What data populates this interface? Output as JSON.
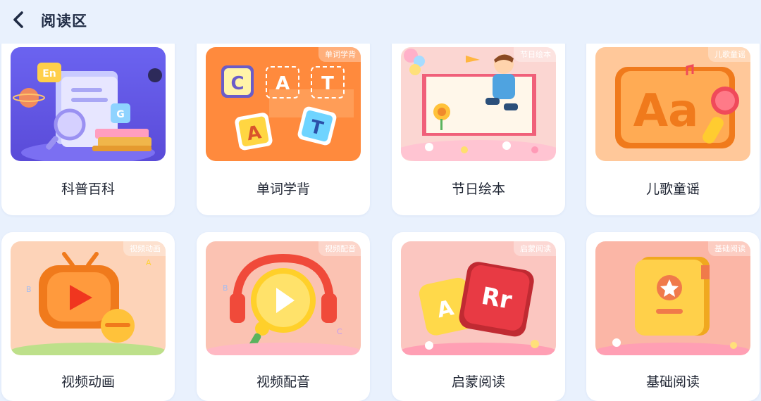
{
  "header": {
    "title": "阅读区"
  },
  "cards": [
    {
      "label": "科普百科",
      "tag": ""
    },
    {
      "label": "单词学背",
      "tag": "单词学背"
    },
    {
      "label": "节日绘本",
      "tag": "节日绘本"
    },
    {
      "label": "儿歌童谣",
      "tag": "儿歌童谣"
    },
    {
      "label": "视频动画",
      "tag": "视频动画"
    },
    {
      "label": "视频配音",
      "tag": "视频配音"
    },
    {
      "label": "启蒙阅读",
      "tag": "启蒙阅读"
    },
    {
      "label": "基础阅读",
      "tag": "基础阅读"
    }
  ],
  "illustration_text": {
    "en_badge": "En",
    "g_badge": "G",
    "cat_letters": [
      "C",
      "A",
      "T",
      "A",
      "T"
    ],
    "aa_letters": "Aa",
    "rr_letters": "Rr",
    "a_letter": "A",
    "b_letter": "B",
    "c_letter": "C"
  },
  "colors": {
    "page_bg": "#e9f1fd",
    "card_bg": "#ffffff",
    "text_primary": "#1f2533"
  }
}
